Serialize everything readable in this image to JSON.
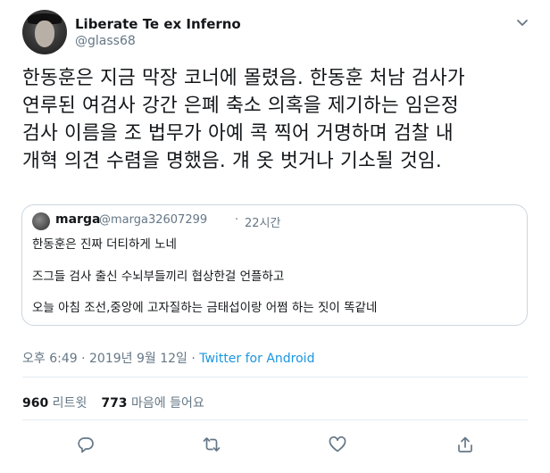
{
  "author": {
    "name": "Liberate Te ex Inferno",
    "handle": "@glass68"
  },
  "tweet": {
    "text": "한동훈은 지금 막장 코너에 몰렸음. 한동훈 처남 검사가\n연루된 여검사 강간 은폐 축소 의혹을 제기하는 임은정\n검사 이름을 조 법무가 아예 콕 찍어 거명하며 검찰 내\n개혁 의견 수렴을 명했음. 걔 옷 벗거나 기소될 것임."
  },
  "quoted_tweet": {
    "name": "marga",
    "handle": "@marga32607299",
    "dot": "·",
    "time": "22시간",
    "lines": [
      "한동훈은 진짜 더티하게 노네",
      "즈그들 검사 출신 수뇌부들끼리 협상한걸 언플하고",
      "오늘 아침 조선,중앙에 고자질하는 금태섭이랑 어쩜 하는 짓이 똑같네"
    ]
  },
  "meta": {
    "timestamp": "오후 6:49 · 2019년 9월 12일 · ",
    "source": "Twitter for Android"
  },
  "stats": {
    "retweets_count": "960",
    "retweets_label": " 리트윗",
    "likes_count": "773",
    "likes_label": " 마음에 들어요"
  },
  "icons": {
    "menu": "chevron-down-icon",
    "reply": "reply-icon",
    "retweet": "retweet-icon",
    "like": "heart-icon",
    "share": "share-icon"
  },
  "colors": {
    "text": "#14171a",
    "secondary": "#657786",
    "link": "#1b95e0",
    "border": "#ccd6dd"
  }
}
